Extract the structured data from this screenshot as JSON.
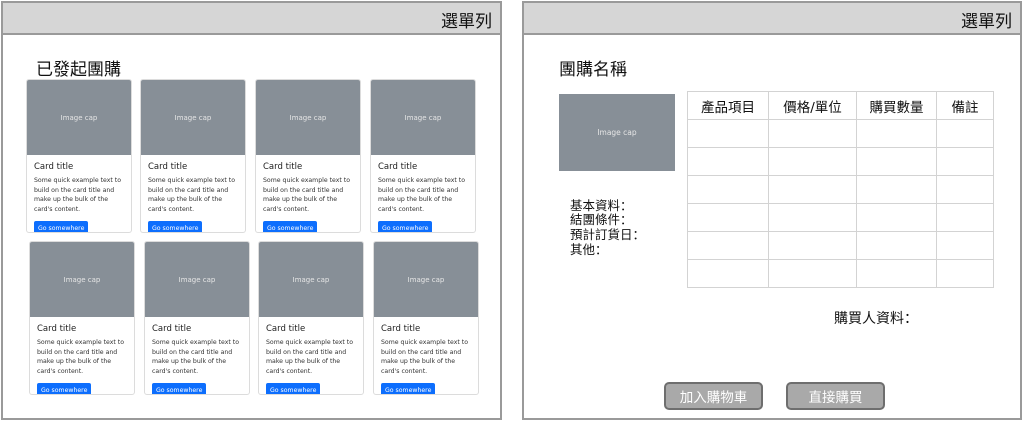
{
  "menu_label": "選單列",
  "left": {
    "title": "已發起團購",
    "cards": [
      {
        "image_cap": "Image cap",
        "title": "Card title",
        "text": "Some quick example text to build on the card title and make up the bulk of the card's content.",
        "button": "Go somewhere"
      },
      {
        "image_cap": "Image cap",
        "title": "Card title",
        "text": "Some quick example text to build on the card title and make up the bulk of the card's content.",
        "button": "Go somewhere"
      },
      {
        "image_cap": "Image cap",
        "title": "Card title",
        "text": "Some quick example text to build on the card title and make up the bulk of the card's content.",
        "button": "Go somewhere"
      },
      {
        "image_cap": "Image cap",
        "title": "Card title",
        "text": "Some quick example text to build on the card title and make up the bulk of the card's content.",
        "button": "Go somewhere"
      },
      {
        "image_cap": "Image cap",
        "title": "Card title",
        "text": "Some quick example text to build on the card title and make up the bulk of the card's content.",
        "button": "Go somewhere"
      },
      {
        "image_cap": "Image cap",
        "title": "Card title",
        "text": "Some quick example text to build on the card title and make up the bulk of the card's content.",
        "button": "Go somewhere"
      },
      {
        "image_cap": "Image cap",
        "title": "Card title",
        "text": "Some quick example text to build on the card title and make up the bulk of the card's content.",
        "button": "Go somewhere"
      },
      {
        "image_cap": "Image cap",
        "title": "Card title",
        "text": "Some quick example text to build on the card title and make up the bulk of the card's content.",
        "button": "Go somewhere"
      }
    ]
  },
  "right": {
    "title": "團購名稱",
    "image_cap": "Image cap",
    "info": [
      "基本資料：",
      "結團條件：",
      "預計訂貨日：",
      "其他："
    ],
    "table": {
      "headers": [
        "產品項目",
        "價格/單位",
        "購買數量",
        "備註"
      ],
      "row_count": 6
    },
    "buyer_label": "購買人資料：",
    "add_cart_button": "加入購物車",
    "buy_now_button": "直接購買"
  },
  "colors": {
    "menubar": "#d6d6d6",
    "image_placeholder": "#878f97",
    "primary_button": "#0d6efd",
    "action_button": "#a9a9a9"
  }
}
